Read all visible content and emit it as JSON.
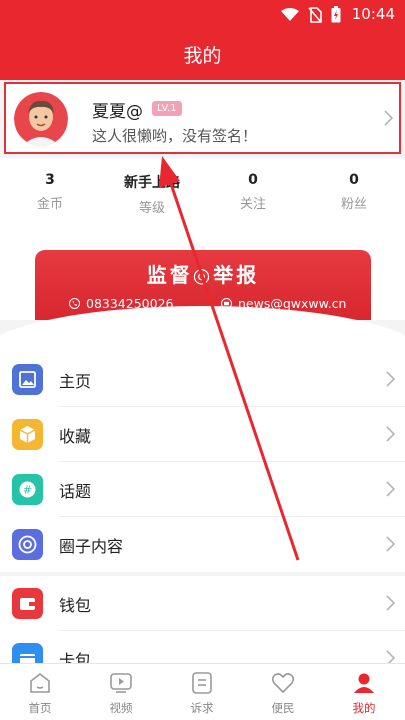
{
  "statusbar": {
    "time": "10:44"
  },
  "header": {
    "title": "我的"
  },
  "profile": {
    "nickname": "夏夏@",
    "level": "LV.1",
    "signature": "这人很懒哟，没有签名！"
  },
  "stats": [
    {
      "value": "3",
      "label": "金币"
    },
    {
      "value": "新手上路",
      "label": "等级"
    },
    {
      "value": "0",
      "label": "关注"
    },
    {
      "value": "0",
      "label": "粉丝"
    }
  ],
  "banner": {
    "title": "监督◎举报",
    "phone": "08334250026",
    "email": "news@qwxww.cn"
  },
  "menu_group1": [
    {
      "label": "主页",
      "icon": "image-icon",
      "color": "#4e72d6"
    },
    {
      "label": "收藏",
      "icon": "box-icon",
      "color": "#f5b631"
    },
    {
      "label": "话题",
      "icon": "hashtag-icon",
      "color": "#25c4a8"
    },
    {
      "label": "圈子内容",
      "icon": "circle-icon",
      "color": "#5a6ee0"
    }
  ],
  "menu_group2": [
    {
      "label": "钱包",
      "icon": "wallet-icon",
      "color": "#e8373d"
    },
    {
      "label": "卡包",
      "icon": "card-icon",
      "color": "#2f8ff0"
    }
  ],
  "tabs": [
    {
      "label": "首页",
      "icon": "home-icon"
    },
    {
      "label": "视频",
      "icon": "video-icon"
    },
    {
      "label": "诉求",
      "icon": "request-icon"
    },
    {
      "label": "便民",
      "icon": "heart-icon"
    },
    {
      "label": "我的",
      "icon": "user-icon",
      "active": true
    }
  ],
  "colors": {
    "brand": "#e8272e",
    "arrow": "#e8272e"
  }
}
